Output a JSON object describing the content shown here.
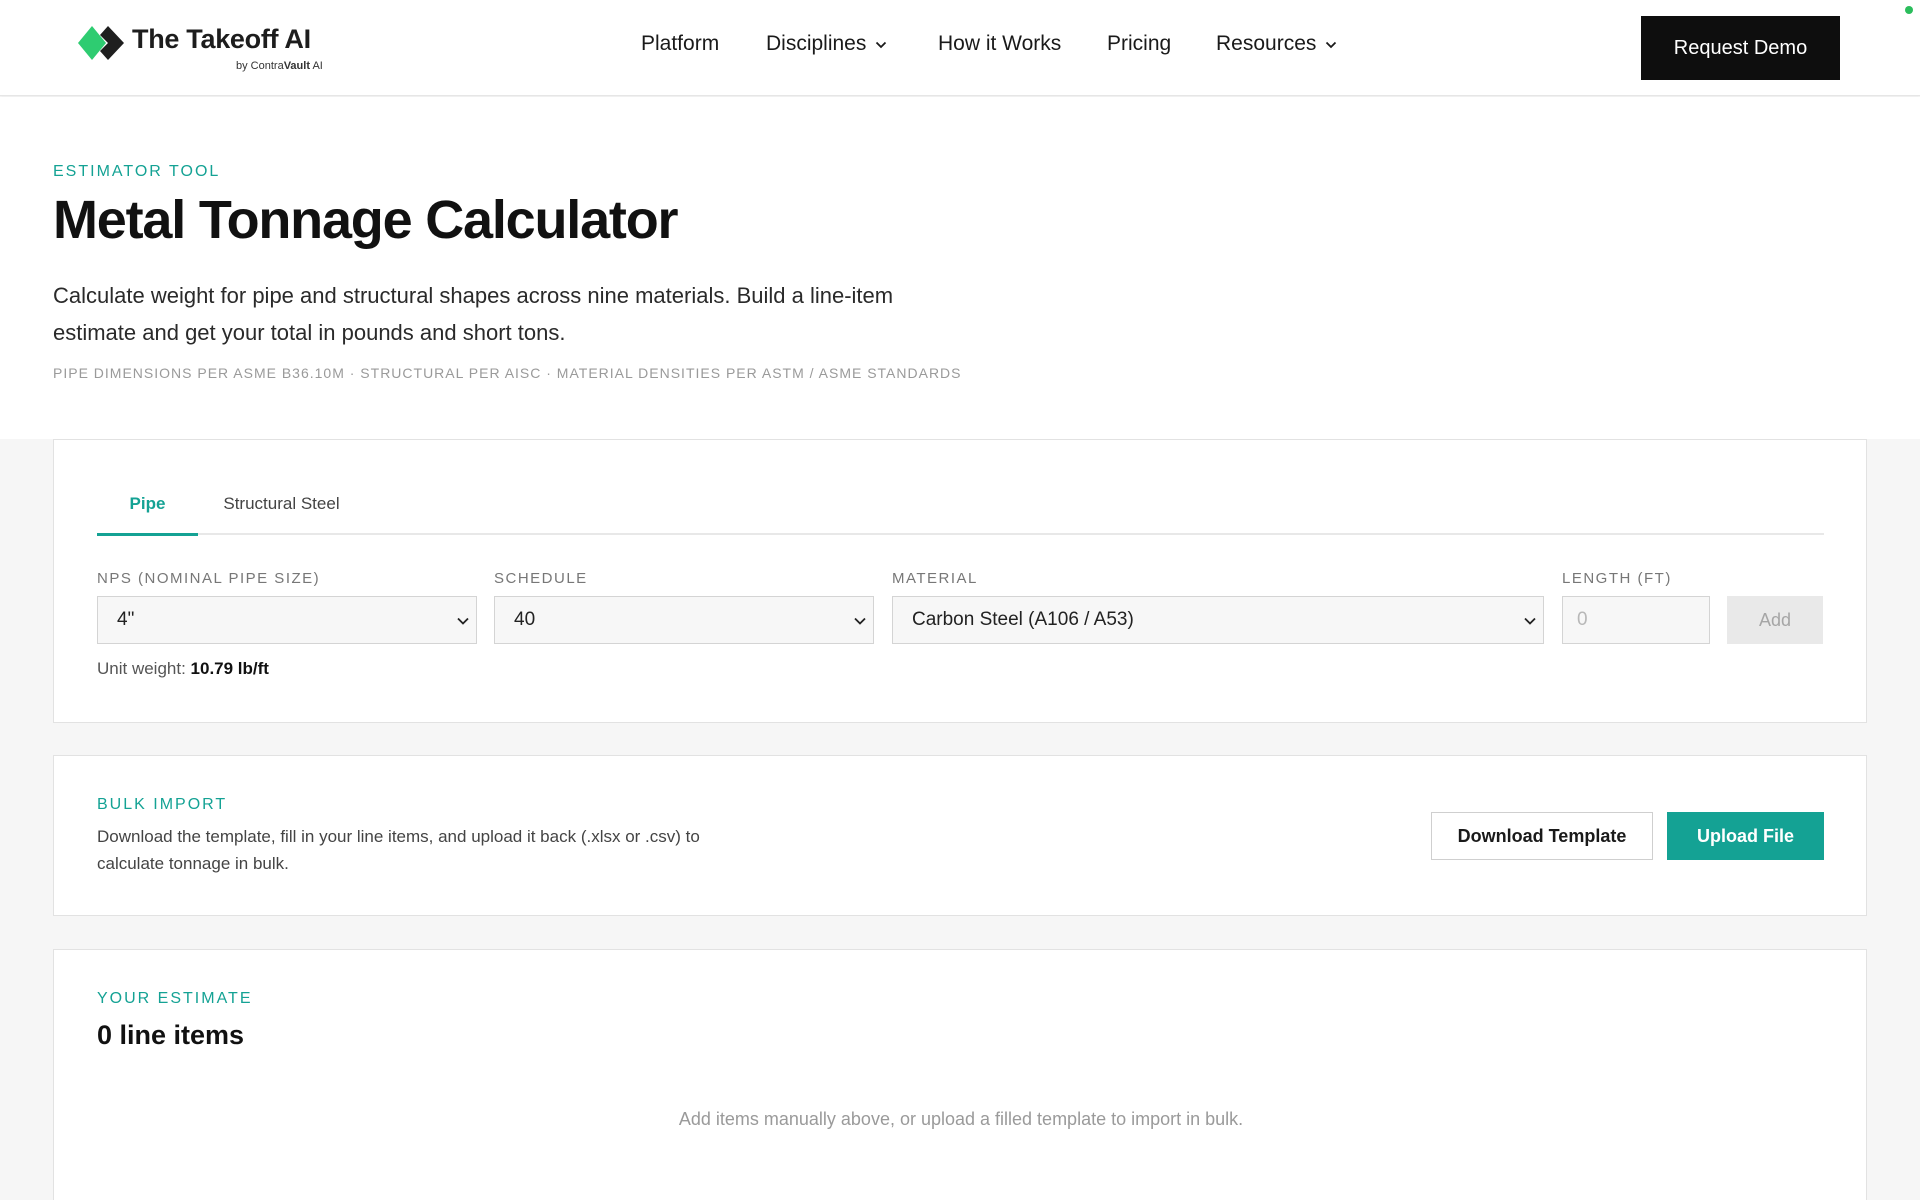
{
  "header": {
    "brand": {
      "title": "The Takeoff AI",
      "sub_prefix": "by Contra",
      "sub_bold": "Vault",
      "sub_suffix": " AI"
    },
    "nav": [
      {
        "label": "Platform",
        "has_dropdown": false
      },
      {
        "label": "Disciplines",
        "has_dropdown": true
      },
      {
        "label": "How it Works",
        "has_dropdown": false
      },
      {
        "label": "Pricing",
        "has_dropdown": false
      },
      {
        "label": "Resources",
        "has_dropdown": true
      }
    ],
    "cta_label": "Request Demo"
  },
  "hero": {
    "eyebrow": "ESTIMATOR TOOL",
    "title": "Metal Tonnage Calculator",
    "description": "Calculate weight for pipe and structural shapes across nine materials. Build a line-item estimate and get your total in pounds and short tons.",
    "note": "PIPE DIMENSIONS PER ASME B36.10M · STRUCTURAL PER AISC · MATERIAL DENSITIES PER ASTM / ASME STANDARDS"
  },
  "calculator": {
    "tabs": [
      {
        "label": "Pipe",
        "active": true
      },
      {
        "label": "Structural Steel",
        "active": false
      }
    ],
    "fields": {
      "nps": {
        "label": "NPS (NOMINAL PIPE SIZE)",
        "value": "4\""
      },
      "schedule": {
        "label": "SCHEDULE",
        "value": "40"
      },
      "material": {
        "label": "MATERIAL",
        "value": "Carbon Steel (A106 / A53)"
      },
      "length": {
        "label": "LENGTH (FT)",
        "value": "",
        "placeholder": "0"
      }
    },
    "add_label": "Add",
    "unit_weight_label": "Unit weight: ",
    "unit_weight_value": "10.79 lb/ft"
  },
  "bulk": {
    "eyebrow": "BULK IMPORT",
    "description": "Download the template, fill in your line items, and upload it back (.xlsx or .csv) to calculate tonnage in bulk.",
    "download_label": "Download Template",
    "upload_label": "Upload File"
  },
  "estimate": {
    "eyebrow": "YOUR ESTIMATE",
    "count_label": "0 line items",
    "empty_message": "Add items manually above, or upload a filled template to import in bulk."
  },
  "colors": {
    "accent": "#14a294",
    "logo_green": "#2ecc71",
    "logo_dark": "#1f1f1f",
    "status_dot": "#2bbd5c"
  },
  "icons": [
    "logo-mark-icon",
    "chevron-down-icon",
    "select-arrow-icon"
  ]
}
